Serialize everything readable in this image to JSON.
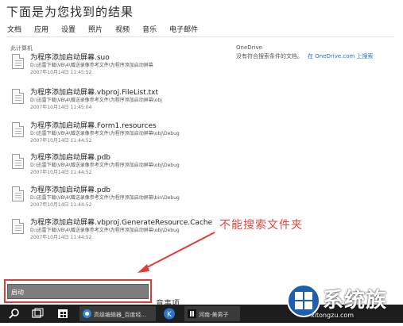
{
  "page": {
    "title": "下面是为您找到的结果"
  },
  "tabs": [
    "文档",
    "应用",
    "设置",
    "照片",
    "视频",
    "音乐",
    "电子邮件"
  ],
  "section_label": "此计算机",
  "onedrive": {
    "heading": "OneDrive",
    "message": "没有符合搜索条件的文档。",
    "link": "在 OneDrive.com 上搜索"
  },
  "results": [
    {
      "name": "为程序添加启动屏幕.suo",
      "path": "D:\\迅雷下载\\VB\\4\\赠送录像参考文件\\为程序添加启动屏幕",
      "date": "2007年10月14日 11:45:52"
    },
    {
      "name": "为程序添加启动屏幕.vbproj.FileList.txt",
      "path": "D:\\迅雷下载\\VB\\4\\赠送录像参考文件\\为程序添加启动屏幕\\obj",
      "date": "2007年10月14日 11:45:04"
    },
    {
      "name": "为程序添加启动屏幕.Form1.resources",
      "path": "D:\\迅雷下载\\VB\\4\\赠送录像参考文件\\为程序添加启动屏幕\\obj\\Debug",
      "date": "2007年10月14日 11:44:52"
    },
    {
      "name": "为程序添加启动屏幕.pdb",
      "path": "D:\\迅雷下载\\VB\\4\\赠送录像参考文件\\为程序添加启动屏幕\\obj\\Debug",
      "date": "2007年10月14日 11:44:52"
    },
    {
      "name": "为程序添加启动屏幕.pdb",
      "path": "D:\\迅雷下载\\VB\\4\\赠送录像参考文件\\为程序添加启动屏幕\\bin\\Debug",
      "date": "2007年10月14日 11:44:52"
    },
    {
      "name": "为程序添加启动屏幕.vbproj.GenerateResource.Cache",
      "path": "D:\\迅雷下载\\VB\\4\\赠送录像参考文件\\为程序添加启动屏幕\\obj\\Debug",
      "date": "2007年10月14日 11:44:52"
    }
  ],
  "annotation": "不能搜索文件夹",
  "bottom_text": "意事项",
  "search": {
    "value": "启动"
  },
  "taskbar": {
    "items": [
      {
        "label": "高级编辑器_百度经..."
      },
      {
        "label": "河南-美男子"
      }
    ]
  },
  "watermark": {
    "text": "系统族",
    "url": "xitongzu.com"
  },
  "colors": {
    "accent_red": "#e53935",
    "link_blue": "#1e6fcc",
    "taskbar": "#1d1d1d"
  },
  "icons": [
    "document-icon",
    "search-icon",
    "task-view-icon",
    "store-icon",
    "browser-icon",
    "k-app-icon",
    "media-app-icon",
    "windows-logo-icon"
  ]
}
